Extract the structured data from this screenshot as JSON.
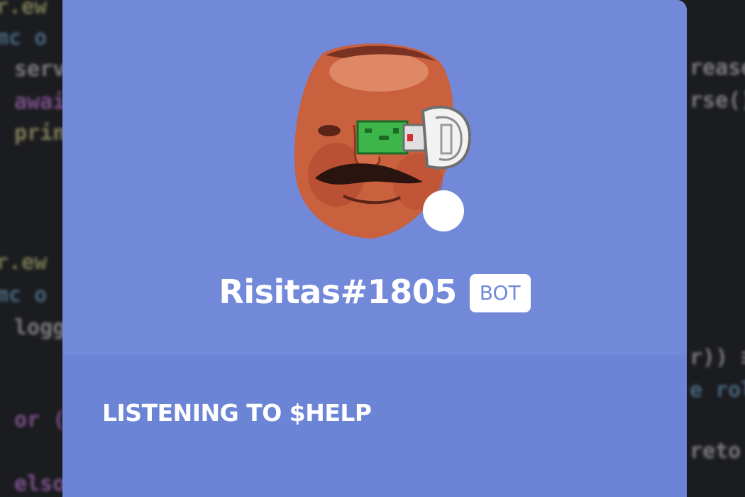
{
  "profile": {
    "username": "Risitas#1805",
    "tag_label": "BOT",
    "activity_text": "LISTENING TO $HELP",
    "status": "online-white",
    "avatar_icon": "risitas-avatar-with-vr-eye-icon"
  },
  "background_code": [
    "r.ew",
    "mc o",
    "serv",
    "awai",
    "print",
    "r.ew",
    "mc o",
    "logg",
    "or (",
    "elso",
    "rease",
    "rse())",
    "r)) ≡",
    "e rol",
    "reto"
  ],
  "colors": {
    "header_bg": "#7289da",
    "body_bg": "#6c84d6",
    "bot_tag_text": "#7289da",
    "text": "#ffffff"
  }
}
